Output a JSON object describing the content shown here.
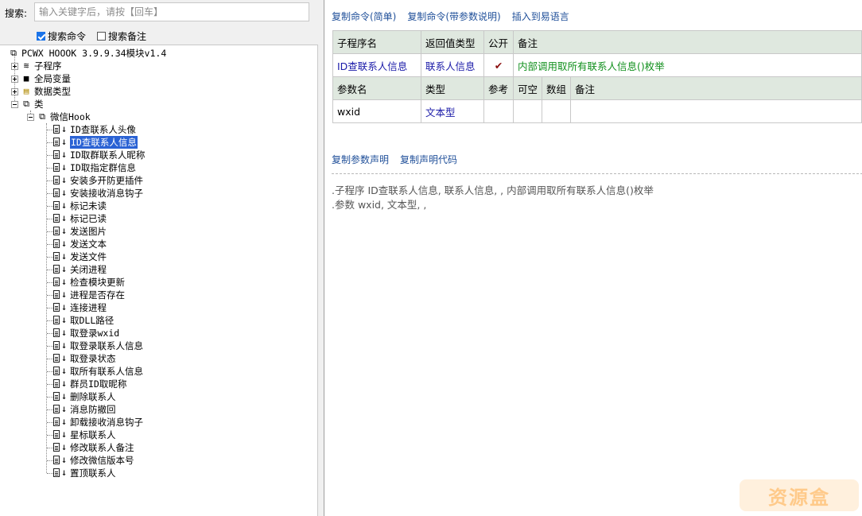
{
  "search": {
    "label": "搜索:",
    "placeholder": "输入关键字后，请按【回车】"
  },
  "options": {
    "search_cmd": "搜索命令",
    "search_note": "搜索备注",
    "search_cmd_checked": true,
    "search_note_checked": false
  },
  "tree": {
    "root": "PCWX HOOOK 3.9.9.34模块v1.4",
    "sub_program": "子程序",
    "global_var": "全局变量",
    "data_type": "数据类型",
    "class": "类",
    "class_child": "微信Hook",
    "items": [
      "ID查联系人头像",
      "ID查联系人信息",
      "ID取群联系人昵称",
      "ID取指定群信息",
      "安装多开防更插件",
      "安装接收消息钩子",
      "标记未读",
      "标记已读",
      "发送图片",
      "发送文本",
      "发送文件",
      "关闭进程",
      "检查模块更新",
      "进程是否存在",
      "连接进程",
      "取DLL路径",
      "取登录wxid",
      "取登录联系人信息",
      "取登录状态",
      "取所有联系人信息",
      "群员ID取昵称",
      "删除联系人",
      "消息防撤回",
      "卸载接收消息钩子",
      "星标联系人",
      "修改联系人备注",
      "修改微信版本号",
      "置顶联系人"
    ],
    "selected_index": 1
  },
  "toplinks": [
    "复制命令(简单)",
    "复制命令(带参数说明)",
    "插入到易语言"
  ],
  "table": {
    "h1": [
      "子程序名",
      "返回值类型",
      "公开",
      "备注"
    ],
    "r1": [
      "ID查联系人信息",
      "联系人信息",
      "✔",
      "内部调用取所有联系人信息()枚举"
    ],
    "h2": [
      "参数名",
      "类型",
      "参考",
      "可空",
      "数组",
      "备注"
    ],
    "r2": [
      "wxid",
      "文本型",
      "",
      "",
      "",
      ""
    ]
  },
  "midlinks": [
    "复制参数声明",
    "复制声明代码"
  ],
  "code": [
    ".子程序 ID查联系人信息, 联系人信息, , 内部调用取所有联系人信息()枚举",
    ".参数 wxid, 文本型, ,"
  ],
  "watermark": "资源盒"
}
